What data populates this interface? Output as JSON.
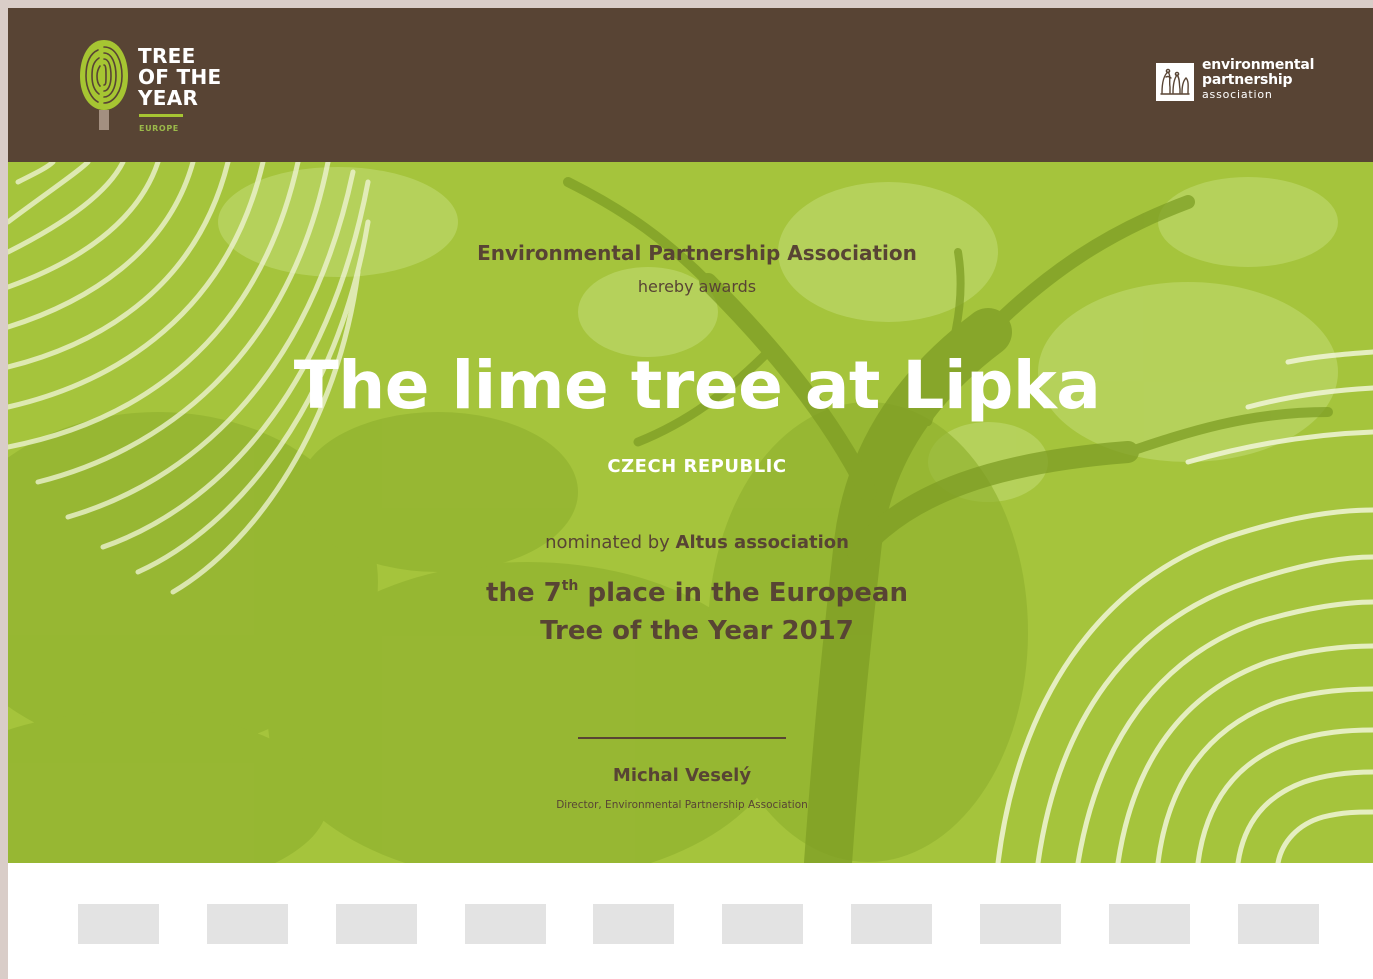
{
  "header": {
    "toy_logo": {
      "line1": "TREE",
      "line2": "OF THE",
      "line3": "YEAR",
      "subtitle": "EUROPE",
      "icon": "fingerprint-tree-icon"
    },
    "partner_logo": {
      "line1": "environmental",
      "line2": "partnership",
      "line3": "association",
      "icon": "partnership-emblem-icon"
    }
  },
  "certificate": {
    "issuer": "Environmental Partnership Association",
    "awards_text": "hereby awards",
    "tree_name": "The lime tree at Lipka",
    "country": "CZECH REPUBLIC",
    "nominated_prefix": "nominated by ",
    "nominator": "Altus association",
    "place_prefix": "the 7",
    "place_suffix": "th",
    "place_rest": " place in the European",
    "place_line2": "Tree of the Year 2017",
    "signer_name": "Michal Veselý",
    "signer_title": "Director, Environmental Partnership Association"
  },
  "footer": {
    "placeholder_count": 10
  },
  "colors": {
    "header_brown": "#584434",
    "hero_green": "#a3c33a",
    "text_brown": "#584434",
    "accent_lime": "#a6c532",
    "placeholder_gray": "#e3e3e3"
  }
}
